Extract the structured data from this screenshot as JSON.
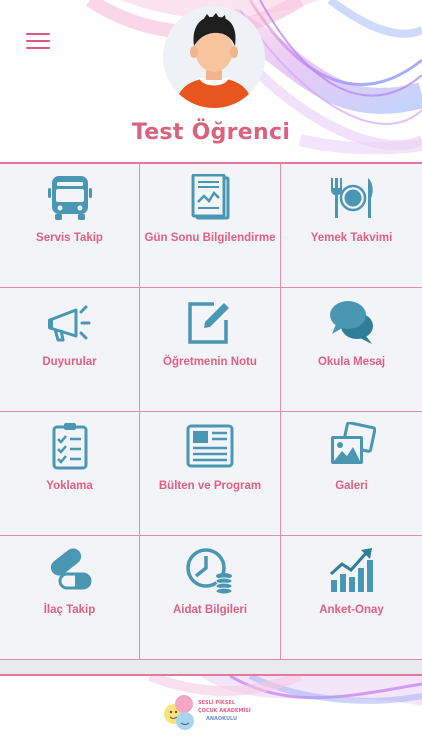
{
  "header": {
    "student_name": "Test Öğrenci"
  },
  "menu_items": [
    {
      "label": "Servis Takip",
      "icon": "bus-icon"
    },
    {
      "label": "Gün Sonu Bilgilendirme",
      "icon": "report-icon"
    },
    {
      "label": "Yemek Takvimi",
      "icon": "plate-cutlery-icon"
    },
    {
      "label": "Duyurular",
      "icon": "megaphone-icon"
    },
    {
      "label": "Öğretmenin Notu",
      "icon": "edit-note-icon"
    },
    {
      "label": "Okula Mesaj",
      "icon": "chat-bubbles-icon"
    },
    {
      "label": "Yoklama",
      "icon": "checklist-clipboard-icon"
    },
    {
      "label": "Bülten ve Program",
      "icon": "newsletter-icon"
    },
    {
      "label": "Galeri",
      "icon": "gallery-icon"
    },
    {
      "label": "İlaç Takip",
      "icon": "pills-icon"
    },
    {
      "label": "Aidat Bilgileri",
      "icon": "clock-coins-icon"
    },
    {
      "label": "Anket-Onay",
      "icon": "growth-chart-icon"
    }
  ],
  "footer": {
    "logo_line1": "SESLİ PİKSEL",
    "logo_line2": "ÇOCUK AKADEMİSİ",
    "logo_line3": "ANAOKULU"
  },
  "colors": {
    "accent_pink": "#e25f80",
    "icon_blue": "#4a97b3",
    "grid_bg": "#f2f4f8"
  }
}
